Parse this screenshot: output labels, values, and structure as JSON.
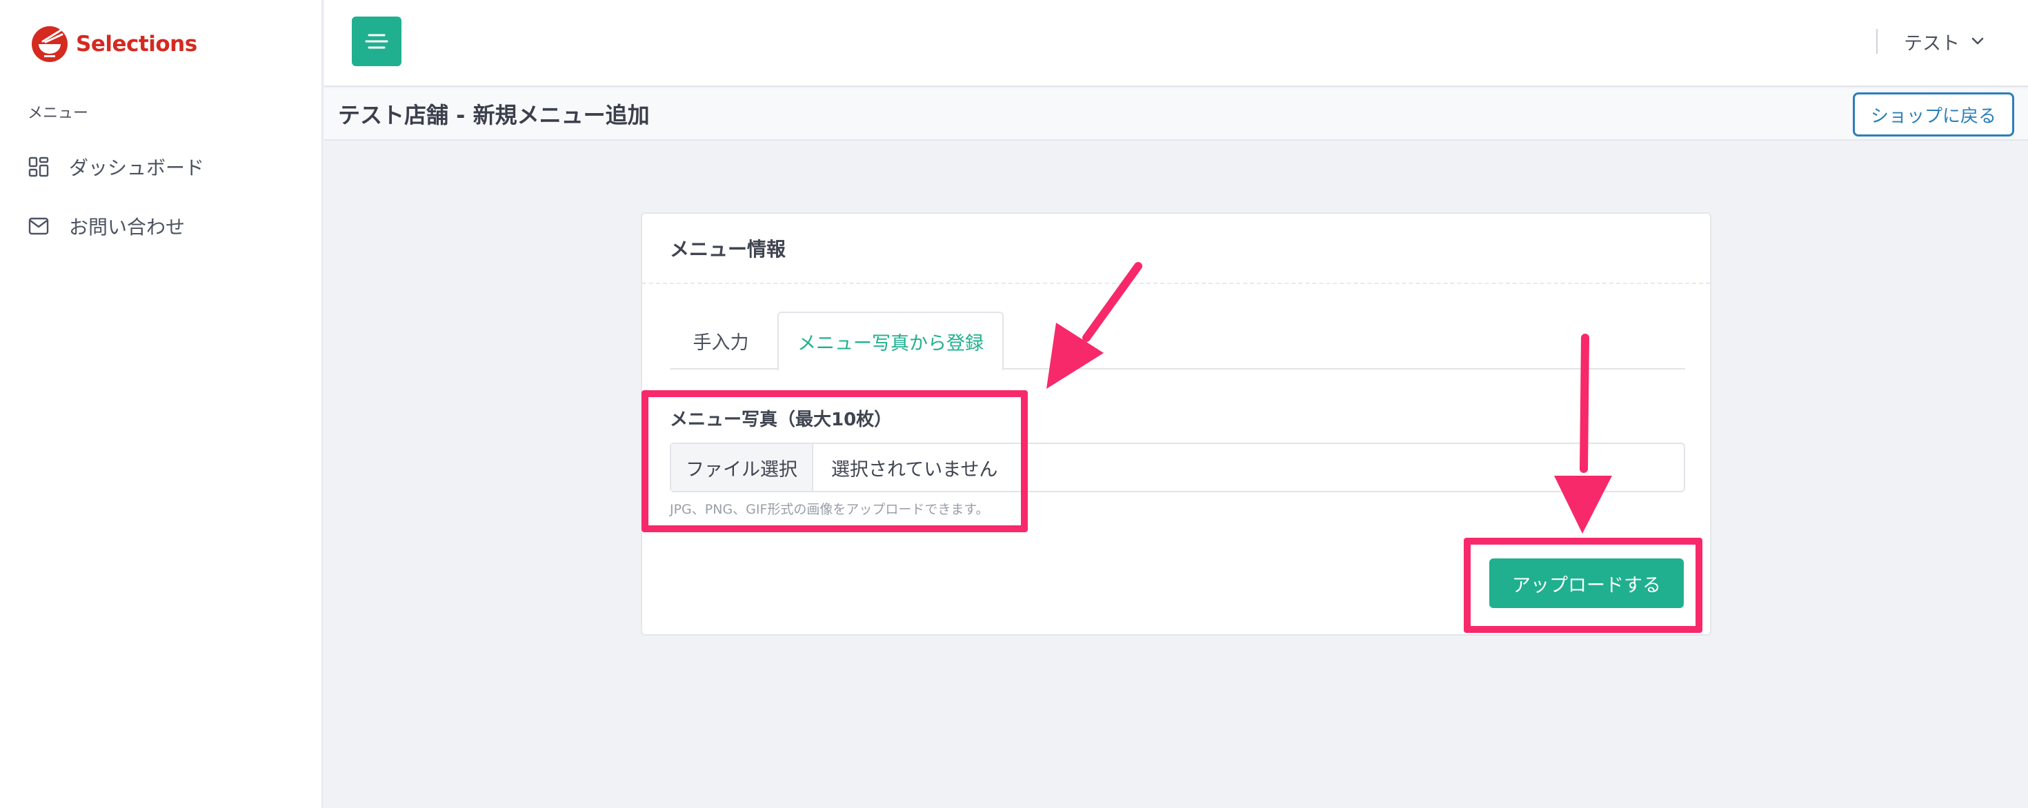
{
  "brand": {
    "name": "Selections",
    "logo_icon": "bowl-chopsticks-icon",
    "accent_color": "#d42a20"
  },
  "sidebar": {
    "heading": "メニュー",
    "items": [
      {
        "label": "ダッシュボード",
        "icon": "dashboard-grid-icon"
      },
      {
        "label": "お問い合わせ",
        "icon": "mail-icon"
      }
    ]
  },
  "topbar": {
    "menu_icon": "hamburger-menu-icon",
    "user_name": "テスト",
    "user_menu_icon": "chevron-down-icon",
    "accent_color": "#20b08f"
  },
  "page": {
    "title": "テスト店舗 - 新規メニュー追加",
    "back_button": "ショップに戻る"
  },
  "card": {
    "title": "メニュー情報",
    "tabs": [
      {
        "label": "手入力",
        "active": false
      },
      {
        "label": "メニュー写真から登録",
        "active": true
      }
    ],
    "field_label": "メニュー写真（最大10枚）",
    "file_button": "ファイル選択",
    "file_status": "選択されていません",
    "help_text": "JPG、PNG、GIF形式の画像をアップロードできます。",
    "upload_button": "アップロードする"
  },
  "annotations": {
    "highlight_color": "#f7296a"
  }
}
